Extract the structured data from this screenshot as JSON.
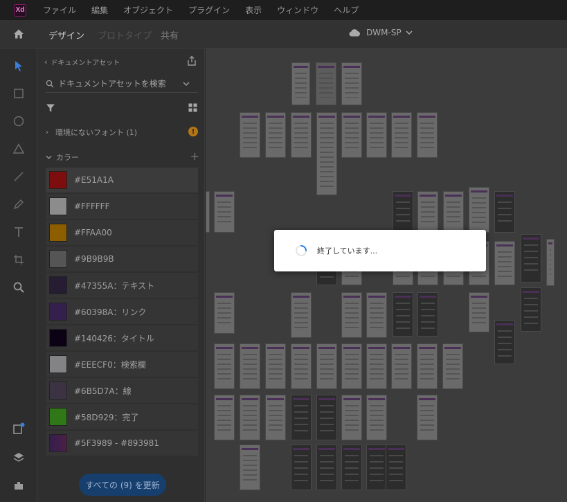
{
  "app": {
    "logo": "Xd"
  },
  "menu": [
    "ファイル",
    "編集",
    "オブジェクト",
    "プラグイン",
    "表示",
    "ウィンドウ",
    "ヘルプ"
  ],
  "tabs": {
    "design": "デザイン",
    "prototype": "プロトタイプ",
    "share": "共有"
  },
  "document": {
    "title": "DWM-SP",
    "cloud_icon": "cloud-icon"
  },
  "assets": {
    "header": "ドキュメントアセット",
    "search_placeholder": "ドキュメントアセットを検索",
    "missing_fonts": "環境にないフォント (1)",
    "colors_header": "カラー",
    "colors": [
      {
        "hex": "#E51A1A",
        "label": "#E51A1A"
      },
      {
        "hex": "#FFFFFF",
        "label": "#FFFFFF"
      },
      {
        "hex": "#FFAA00",
        "label": "#FFAA00"
      },
      {
        "hex": "#9B9B9B",
        "label": "#9B9B9B"
      },
      {
        "hex": "#47355A",
        "label": "#47355A：テキスト"
      },
      {
        "hex": "#60398A",
        "label": "#60398A：リンク"
      },
      {
        "hex": "#140426",
        "label": "#140426：タイトル"
      },
      {
        "hex": "#EEECF0",
        "label": "#EEECF0：検索欄"
      },
      {
        "hex": "#6B5D7A",
        "label": "#6B5D7A：線"
      },
      {
        "hex": "#58D929",
        "label": "#58D929：完了"
      },
      {
        "hex": "#5F3989",
        "label": "#5F3989 - #893981"
      }
    ],
    "update_button": "すべての (9) を更新"
  },
  "modal": {
    "message": "終了しています..."
  },
  "colors": {
    "overlay_dim": "#000000",
    "accent": "#2680EB"
  }
}
